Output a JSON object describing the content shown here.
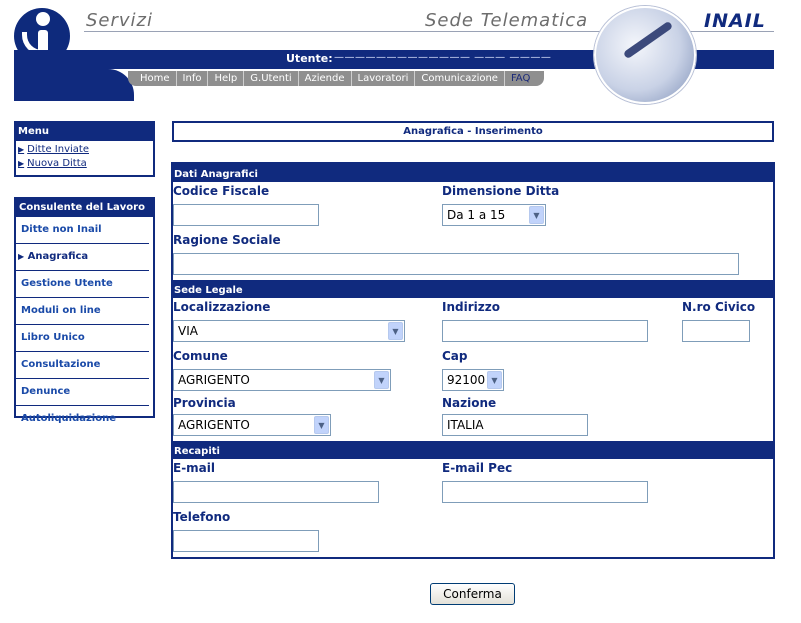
{
  "header": {
    "servizi": "Servizi",
    "sede_telematica": "Sede Telematica",
    "brand": "INAIL",
    "utente_label": "Utente:",
    "utente_value": "————————————— ——— ————",
    "nav": [
      "Home",
      "Info",
      "Help",
      "G.Utenti",
      "Aziende",
      "Lavoratori",
      "Comunicazione",
      "FAQ"
    ]
  },
  "sidebar": {
    "menu_title": "Menu",
    "menu_items": [
      "Ditte Inviate",
      "Nuova Ditta"
    ],
    "section_title": "Consulente del Lavoro",
    "items": [
      "Ditte non Inail",
      "Anagrafica",
      "Gestione Utente",
      "Moduli on line",
      "Libro Unico",
      "Consultazione",
      "Denunce",
      "Autoliquidazione"
    ],
    "active_item": "Anagrafica"
  },
  "page": {
    "title": "Anagrafica - Inserimento"
  },
  "form": {
    "dati_anagrafici": {
      "header": "Dati Anagrafici",
      "codice_fiscale_label": "Codice Fiscale",
      "codice_fiscale_value": "",
      "dimensione_label": "Dimensione Ditta",
      "dimensione_value": "Da 1 a 15",
      "ragione_sociale_label": "Ragione Sociale",
      "ragione_sociale_value": ""
    },
    "sede_legale": {
      "header": "Sede Legale",
      "localizzazione_label": "Localizzazione",
      "localizzazione_value": "VIA",
      "indirizzo_label": "Indirizzo",
      "indirizzo_value": "",
      "civico_label": "N.ro Civico",
      "civico_value": "",
      "comune_label": "Comune",
      "comune_value": "AGRIGENTO",
      "cap_label": "Cap",
      "cap_value": "92100",
      "provincia_label": "Provincia",
      "provincia_value": "AGRIGENTO",
      "nazione_label": "Nazione",
      "nazione_value": "ITALIA"
    },
    "recapiti": {
      "header": "Recapiti",
      "email_label": "E-mail",
      "email_value": "",
      "pec_label": "E-mail Pec",
      "pec_value": "",
      "telefono_label": "Telefono",
      "telefono_value": ""
    },
    "submit_label": "Conferma"
  },
  "colors": {
    "primary": "#102a7e",
    "nav_gray": "#8f8f8f",
    "link": "#1a4aa8"
  }
}
